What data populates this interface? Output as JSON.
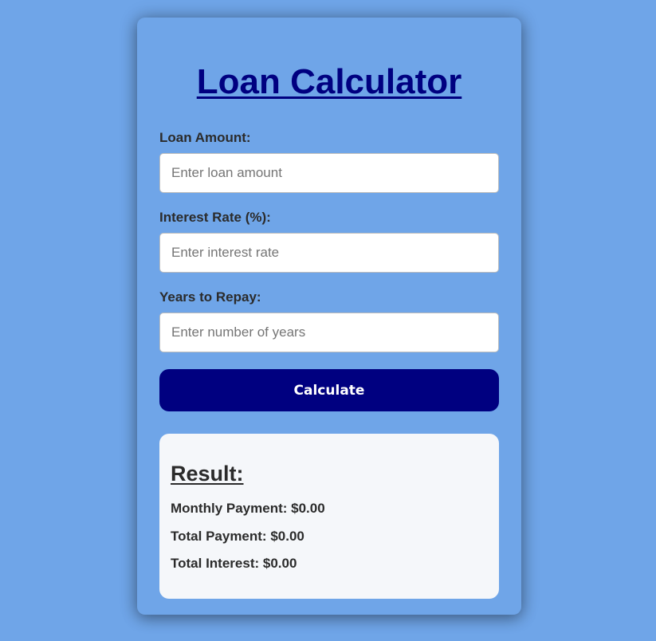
{
  "app": {
    "title": "Loan Calculator"
  },
  "form": {
    "loan_amount": {
      "label": "Loan Amount:",
      "value": "",
      "placeholder": "Enter loan amount"
    },
    "interest_rate": {
      "label": "Interest Rate (%):",
      "value": "",
      "placeholder": "Enter interest rate"
    },
    "years": {
      "label": "Years to Repay:",
      "value": "",
      "placeholder": "Enter number of years"
    },
    "calculate_label": "Calculate"
  },
  "result": {
    "heading": "Result:",
    "monthly_payment": "Monthly Payment: $0.00",
    "total_payment": "Total Payment: $0.00",
    "total_interest": "Total Interest: $0.00"
  },
  "colors": {
    "page_background": "#6fa5e8",
    "title": "#000080",
    "button": "#000080",
    "result_background": "#f5f7fa"
  }
}
